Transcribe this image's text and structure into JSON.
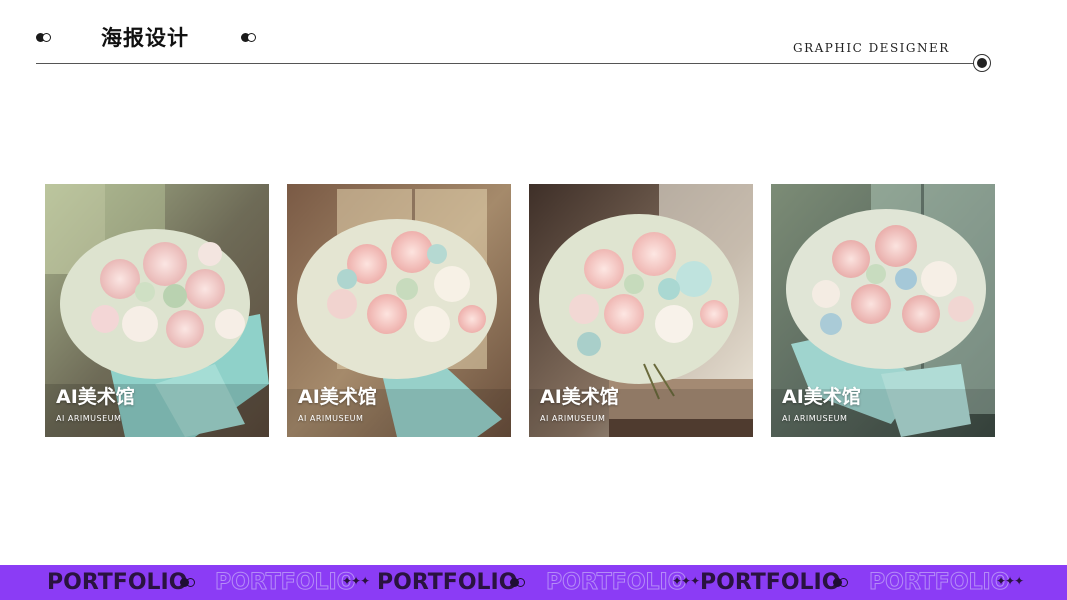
{
  "header": {
    "title": "海报设计",
    "subtitle": "GRAPHIC DESIGNER"
  },
  "cards": [
    {
      "brand": "AI美术馆",
      "brand_sub": "AI ARIMUSEUM",
      "image": "flower-bouquet-mint-wrap-window"
    },
    {
      "brand": "AI美术馆",
      "brand_sub": "AI ARIMUSEUM",
      "image": "flower-bouquet-mint-ribbon-window"
    },
    {
      "brand": "AI美术馆",
      "brand_sub": "AI ARIMUSEUM",
      "image": "flower-bouquet-on-table-window"
    },
    {
      "brand": "AI美术馆",
      "brand_sub": "AI ARIMUSEUM",
      "image": "flower-bouquet-blue-wrap-window"
    }
  ],
  "ticker": {
    "items": [
      "PORTFOLIO",
      "PORTFOLIO",
      "PORTFOLIO",
      "PORTFOLIO",
      "PORTFOLIO",
      "PORTFOLIO"
    ],
    "sparks": "✦✦✦"
  },
  "colors": {
    "ticker_bg": "#8b3cf5",
    "accent_dark": "#2a1340"
  }
}
